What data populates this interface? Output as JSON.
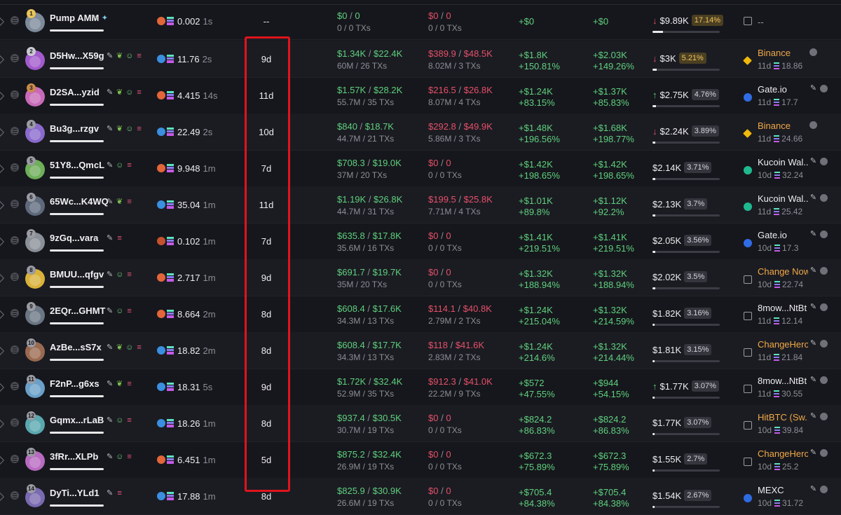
{
  "rows": [
    {
      "rank": "1",
      "name": "Pump AMM",
      "tags": [
        "pencil",
        "pill"
      ],
      "platform": "flame",
      "platform_color": "#e2663a",
      "bal": "0.002",
      "bal_t": "1s",
      "age": "--",
      "bought": {
        "usd": "$0",
        "sol": "0",
        "sub": "0 / 0 TXs"
      },
      "sold": {
        "usd": "$0",
        "sol": "0",
        "sub": "0 / 0 TXs"
      },
      "pnl1": {
        "usd": "+$0",
        "pct": ""
      },
      "pnl2": {
        "usd": "+$0",
        "pct": ""
      },
      "hold": {
        "dir": "down",
        "usd": "$9.89K",
        "pct": "17.14%",
        "pct_style": "warn",
        "fill": 0.16
      },
      "src": {
        "kind": "exch",
        "name": "--",
        "style": "white",
        "sub": "",
        "sub_sol": ""
      },
      "avatar": "#7d8a9a",
      "underline": 1.0
    },
    {
      "rank": "2",
      "name": "D5Hw...X59g",
      "tags": [
        "pencil",
        "frog",
        "person",
        "stack"
      ],
      "platform": "eye",
      "platform_color": "#3a8fe0",
      "bal": "11.76",
      "bal_t": "2s",
      "age": "9d",
      "bought": {
        "usd": "$1.34K",
        "sol": "$22.4K",
        "sub": "60M / 26 TXs"
      },
      "sold": {
        "usd": "$389.9",
        "sol": "$48.5K",
        "sub": "8.02M / 3 TXs"
      },
      "pnl1": {
        "usd": "+$1.8K",
        "pct": "+150.81%"
      },
      "pnl2": {
        "usd": "+$2.03K",
        "pct": "+149.26%"
      },
      "hold": {
        "dir": "down",
        "usd": "$3K",
        "pct": "5.21%",
        "pct_style": "warn",
        "fill": 0.06
      },
      "src": {
        "kind": "binance",
        "name": "Binance",
        "style": "orange",
        "sub": "11d",
        "sub_sol": "18.86"
      },
      "avatar": "#a25acc",
      "underline": 1.0
    },
    {
      "rank": "3",
      "name": "D2SA...yzid",
      "tags": [
        "pencil",
        "frog",
        "person",
        "stack"
      ],
      "platform": "flame",
      "platform_color": "#e2663a",
      "bal": "4.415",
      "bal_t": "14s",
      "age": "11d",
      "bought": {
        "usd": "$1.57K",
        "sol": "$28.2K",
        "sub": "55.7M / 35 TXs"
      },
      "sold": {
        "usd": "$216.5",
        "sol": "$26.8K",
        "sub": "8.07M / 4 TXs"
      },
      "pnl1": {
        "usd": "+$1.24K",
        "pct": "+83.15%"
      },
      "pnl2": {
        "usd": "+$1.37K",
        "pct": "+85.83%"
      },
      "hold": {
        "dir": "up",
        "usd": "$2.75K",
        "pct": "4.76%",
        "pct_style": "",
        "fill": 0.05
      },
      "src": {
        "kind": "gate",
        "name": "Gate.io",
        "style": "white",
        "sub": "11d",
        "sub_sol": "17.7"
      },
      "avatar": "#c86ab8",
      "underline": 1.0
    },
    {
      "rank": "4",
      "name": "Bu3g...rzgv",
      "tags": [
        "pencil",
        "frog",
        "person",
        "stack"
      ],
      "platform": "eye",
      "platform_color": "#3a8fe0",
      "bal": "22.49",
      "bal_t": "2s",
      "age": "10d",
      "bought": {
        "usd": "$840",
        "sol": "$18.7K",
        "sub": "44.7M / 21 TXs"
      },
      "sold": {
        "usd": "$292.8",
        "sol": "$49.9K",
        "sub": "5.86M / 3 TXs"
      },
      "pnl1": {
        "usd": "+$1.48K",
        "pct": "+196.56%"
      },
      "pnl2": {
        "usd": "+$1.68K",
        "pct": "+198.77%"
      },
      "hold": {
        "dir": "down",
        "usd": "$2.24K",
        "pct": "3.89%",
        "pct_style": "",
        "fill": 0.04
      },
      "src": {
        "kind": "binance",
        "name": "Binance",
        "style": "orange",
        "sub": "11d",
        "sub_sol": "24.66"
      },
      "avatar": "#8a6acd",
      "underline": 1.0
    },
    {
      "rank": "5",
      "name": "51Y8...QmcL",
      "tags": [
        "pencil",
        "person",
        "stack"
      ],
      "platform": "flame",
      "platform_color": "#e2663a",
      "bal": "9.948",
      "bal_t": "1m",
      "age": "7d",
      "bought": {
        "usd": "$708.3",
        "sol": "$19.0K",
        "sub": "37M / 20 TXs"
      },
      "sold": {
        "usd": "$0",
        "sol": "0",
        "sub": "0 / 0 TXs"
      },
      "pnl1": {
        "usd": "+$1.42K",
        "pct": "+198.65%"
      },
      "pnl2": {
        "usd": "+$1.42K",
        "pct": "+198.65%"
      },
      "hold": {
        "dir": "",
        "usd": "$2.14K",
        "pct": "3.71%",
        "pct_style": "",
        "fill": 0.04
      },
      "src": {
        "kind": "kucoin",
        "name": "Kucoin Wal...",
        "style": "white",
        "sub": "10d",
        "sub_sol": "32.24"
      },
      "avatar": "#6fae5a",
      "underline": 1.0
    },
    {
      "rank": "6",
      "name": "65Wc...K4WQ",
      "tags": [
        "pencil",
        "frog",
        "stack"
      ],
      "platform": "eye",
      "platform_color": "#3a8fe0",
      "bal": "35.04",
      "bal_t": "1m",
      "age": "11d",
      "bought": {
        "usd": "$1.19K",
        "sol": "$26.8K",
        "sub": "44.7M / 31 TXs"
      },
      "sold": {
        "usd": "$199.5",
        "sol": "$25.8K",
        "sub": "7.71M / 4 TXs"
      },
      "pnl1": {
        "usd": "+$1.01K",
        "pct": "+89.8%"
      },
      "pnl2": {
        "usd": "+$1.12K",
        "pct": "+92.2%"
      },
      "hold": {
        "dir": "",
        "usd": "$2.13K",
        "pct": "3.7%",
        "pct_style": "",
        "fill": 0.04
      },
      "src": {
        "kind": "kucoin",
        "name": "Kucoin Wal...",
        "style": "white",
        "sub": "11d",
        "sub_sol": "25.42"
      },
      "avatar": "#5e6a7c",
      "underline": 1.0
    },
    {
      "rank": "7",
      "name": "9zGq...vara",
      "tags": [
        "pencil",
        "stack"
      ],
      "platform": "flame",
      "platform_color": "#c4522e",
      "bal": "0.102",
      "bal_t": "1m",
      "age": "7d",
      "bought": {
        "usd": "$635.8",
        "sol": "$17.8K",
        "sub": "35.6M / 16 TXs"
      },
      "sold": {
        "usd": "$0",
        "sol": "0",
        "sub": "0 / 0 TXs"
      },
      "pnl1": {
        "usd": "+$1.41K",
        "pct": "+219.51%"
      },
      "pnl2": {
        "usd": "+$1.41K",
        "pct": "+219.51%"
      },
      "hold": {
        "dir": "",
        "usd": "$2.05K",
        "pct": "3.56%",
        "pct_style": "",
        "fill": 0.04
      },
      "src": {
        "kind": "gate",
        "name": "Gate.io",
        "style": "white",
        "sub": "10d",
        "sub_sol": "17.3"
      },
      "avatar": "#8a8f98",
      "underline": 1.0
    },
    {
      "rank": "8",
      "name": "BMUU...qfgv",
      "tags": [
        "pencil",
        "person",
        "stack"
      ],
      "platform": "flame",
      "platform_color": "#e2663a",
      "bal": "2.717",
      "bal_t": "1m",
      "age": "9d",
      "bought": {
        "usd": "$691.7",
        "sol": "$19.7K",
        "sub": "35M / 20 TXs"
      },
      "sold": {
        "usd": "$0",
        "sol": "0",
        "sub": "0 / 0 TXs"
      },
      "pnl1": {
        "usd": "+$1.32K",
        "pct": "+188.94%"
      },
      "pnl2": {
        "usd": "+$1.32K",
        "pct": "+188.94%"
      },
      "hold": {
        "dir": "",
        "usd": "$2.02K",
        "pct": "3.5%",
        "pct_style": "",
        "fill": 0.04
      },
      "src": {
        "kind": "exch",
        "name": "Change Now",
        "style": "orange",
        "sub": "10d",
        "sub_sol": "22.74"
      },
      "avatar": "#d9b23a",
      "underline": 1.0
    },
    {
      "rank": "9",
      "name": "2EQr...GHMT",
      "tags": [
        "pencil",
        "person",
        "stack"
      ],
      "platform": "flame",
      "platform_color": "#e2663a",
      "bal": "8.664",
      "bal_t": "2m",
      "age": "8d",
      "bought": {
        "usd": "$608.4",
        "sol": "$17.6K",
        "sub": "34.3M / 13 TXs"
      },
      "sold": {
        "usd": "$114.1",
        "sol": "$40.8K",
        "sub": "2.79M / 2 TXs"
      },
      "pnl1": {
        "usd": "+$1.24K",
        "pct": "+215.04%"
      },
      "pnl2": {
        "usd": "+$1.32K",
        "pct": "+214.59%"
      },
      "hold": {
        "dir": "",
        "usd": "$1.82K",
        "pct": "3.16%",
        "pct_style": "",
        "fill": 0.03
      },
      "src": {
        "kind": "exch",
        "name": "8mow...NtBt",
        "style": "white",
        "sub": "11d",
        "sub_sol": "12.14"
      },
      "avatar": "#6a7684",
      "underline": 1.0
    },
    {
      "rank": "10",
      "name": "AzBe...sS7x",
      "tags": [
        "pencil",
        "frog",
        "person",
        "stack"
      ],
      "platform": "eye",
      "platform_color": "#3a8fe0",
      "bal": "18.82",
      "bal_t": "2m",
      "age": "8d",
      "bought": {
        "usd": "$608.4",
        "sol": "$17.7K",
        "sub": "34.3M / 13 TXs"
      },
      "sold": {
        "usd": "$118",
        "sol": "$41.6K",
        "sub": "2.83M / 2 TXs"
      },
      "pnl1": {
        "usd": "+$1.24K",
        "pct": "+214.6%"
      },
      "pnl2": {
        "usd": "+$1.32K",
        "pct": "+214.44%"
      },
      "hold": {
        "dir": "",
        "usd": "$1.81K",
        "pct": "3.15%",
        "pct_style": "",
        "fill": 0.03
      },
      "src": {
        "kind": "exch",
        "name": "ChangeHero",
        "style": "orange",
        "sub": "11d",
        "sub_sol": "21.84"
      },
      "avatar": "#9a6a50",
      "underline": 1.0
    },
    {
      "rank": "11",
      "name": "F2nP...g6xs",
      "tags": [
        "pencil",
        "frog",
        "stack"
      ],
      "platform": "eye",
      "platform_color": "#3a8fe0",
      "bal": "18.31",
      "bal_t": "5s",
      "age": "9d",
      "bought": {
        "usd": "$1.72K",
        "sol": "$32.4K",
        "sub": "52.9M / 35 TXs"
      },
      "sold": {
        "usd": "$912.3",
        "sol": "$41.0K",
        "sub": "22.2M / 9 TXs"
      },
      "pnl1": {
        "usd": "+$572",
        "pct": "+47.55%"
      },
      "pnl2": {
        "usd": "+$944",
        "pct": "+54.15%"
      },
      "hold": {
        "dir": "up",
        "usd": "$1.77K",
        "pct": "3.07%",
        "pct_style": "",
        "fill": 0.03
      },
      "src": {
        "kind": "exch",
        "name": "8mow...NtBt",
        "style": "white",
        "sub": "11d",
        "sub_sol": "30.55"
      },
      "avatar": "#6aa0c8",
      "underline": 1.0
    },
    {
      "rank": "12",
      "name": "Gqmx...rLaB",
      "tags": [
        "pencil",
        "person",
        "stack"
      ],
      "platform": "eye",
      "platform_color": "#3a8fe0",
      "bal": "18.26",
      "bal_t": "1m",
      "age": "8d",
      "bought": {
        "usd": "$937.4",
        "sol": "$30.5K",
        "sub": "30.7M / 19 TXs"
      },
      "sold": {
        "usd": "$0",
        "sol": "0",
        "sub": "0 / 0 TXs"
      },
      "pnl1": {
        "usd": "+$824.2",
        "pct": "+86.83%"
      },
      "pnl2": {
        "usd": "+$824.2",
        "pct": "+86.83%"
      },
      "hold": {
        "dir": "",
        "usd": "$1.77K",
        "pct": "3.07%",
        "pct_style": "",
        "fill": 0.03
      },
      "src": {
        "kind": "exch",
        "name": "HitBTC (Sw...",
        "style": "orange",
        "sub": "10d",
        "sub_sol": "39.84"
      },
      "avatar": "#5aa8b0",
      "underline": 1.0
    },
    {
      "rank": "13",
      "name": "3fRr...XLPb",
      "tags": [
        "pencil",
        "person",
        "stack"
      ],
      "platform": "flame",
      "platform_color": "#e2663a",
      "bal": "6.451",
      "bal_t": "1m",
      "age": "5d",
      "bought": {
        "usd": "$875.2",
        "sol": "$32.4K",
        "sub": "26.9M / 19 TXs"
      },
      "sold": {
        "usd": "$0",
        "sol": "0",
        "sub": "0 / 0 TXs"
      },
      "pnl1": {
        "usd": "+$672.3",
        "pct": "+75.89%"
      },
      "pnl2": {
        "usd": "+$672.3",
        "pct": "+75.89%"
      },
      "hold": {
        "dir": "",
        "usd": "$1.55K",
        "pct": "2.7%",
        "pct_style": "",
        "fill": 0.03
      },
      "src": {
        "kind": "exch",
        "name": "ChangeHero",
        "style": "orange",
        "sub": "10d",
        "sub_sol": "25.2"
      },
      "avatar": "#b86ac0",
      "underline": 1.0
    },
    {
      "rank": "14",
      "name": "DyTi...YLd1",
      "tags": [
        "pencil",
        "stack"
      ],
      "platform": "eye",
      "platform_color": "#3a8fe0",
      "bal": "17.88",
      "bal_t": "1m",
      "age": "8d",
      "bought": {
        "usd": "$825.9",
        "sol": "$30.9K",
        "sub": "26.6M / 19 TXs"
      },
      "sold": {
        "usd": "$0",
        "sol": "0",
        "sub": "0 / 0 TXs"
      },
      "pnl1": {
        "usd": "+$705.4",
        "pct": "+84.38%"
      },
      "pnl2": {
        "usd": "+$705.4",
        "pct": "+84.38%"
      },
      "hold": {
        "dir": "",
        "usd": "$1.54K",
        "pct": "2.67%",
        "pct_style": "",
        "fill": 0.03
      },
      "src": {
        "kind": "mexc",
        "name": "MEXC",
        "style": "white",
        "sub": "10d",
        "sub_sol": "31.72"
      },
      "avatar": "#7a6ab0",
      "underline": 1.0
    }
  ]
}
